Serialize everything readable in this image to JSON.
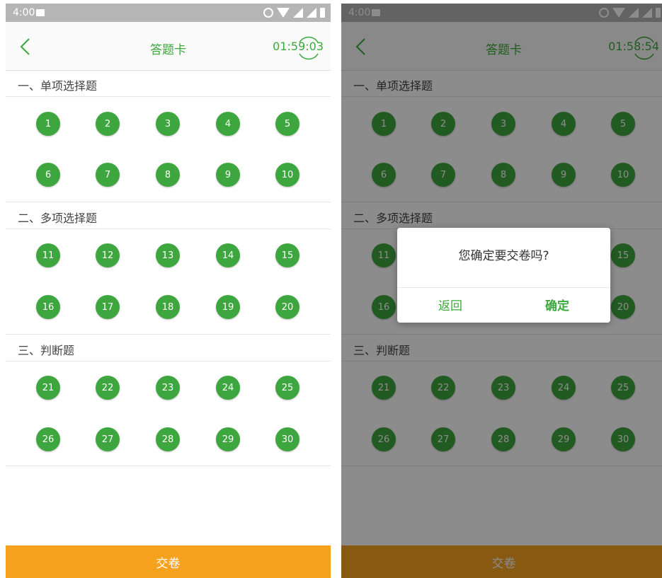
{
  "statusbar": {
    "time": "4:00"
  },
  "left": {
    "title": "答题卡",
    "timer": "01:59:03",
    "submit_label": "交卷"
  },
  "right": {
    "title": "答题卡",
    "timer": "01:58:54",
    "submit_label": "交卷"
  },
  "sections": [
    {
      "title": "一、单项选择题",
      "questions": [
        "1",
        "2",
        "3",
        "4",
        "5",
        "6",
        "7",
        "8",
        "9",
        "10"
      ]
    },
    {
      "title": "二、多项选择题",
      "questions": [
        "11",
        "12",
        "13",
        "14",
        "15",
        "16",
        "17",
        "18",
        "19",
        "20"
      ]
    },
    {
      "title": "三、判断题",
      "questions": [
        "21",
        "22",
        "23",
        "24",
        "25",
        "26",
        "27",
        "28",
        "29",
        "30"
      ]
    }
  ],
  "dialog": {
    "message": "您确定要交卷吗?",
    "cancel_label": "返回",
    "confirm_label": "确定"
  },
  "colors": {
    "accent": "#3ba83b",
    "question_fill": "#3ea63e",
    "submit_bar": "#f7a21e"
  },
  "icons": [
    "back-chevron-icon",
    "alarm-icon",
    "wifi-icon",
    "signal-icon",
    "battery-icon",
    "image-notification-icon"
  ]
}
